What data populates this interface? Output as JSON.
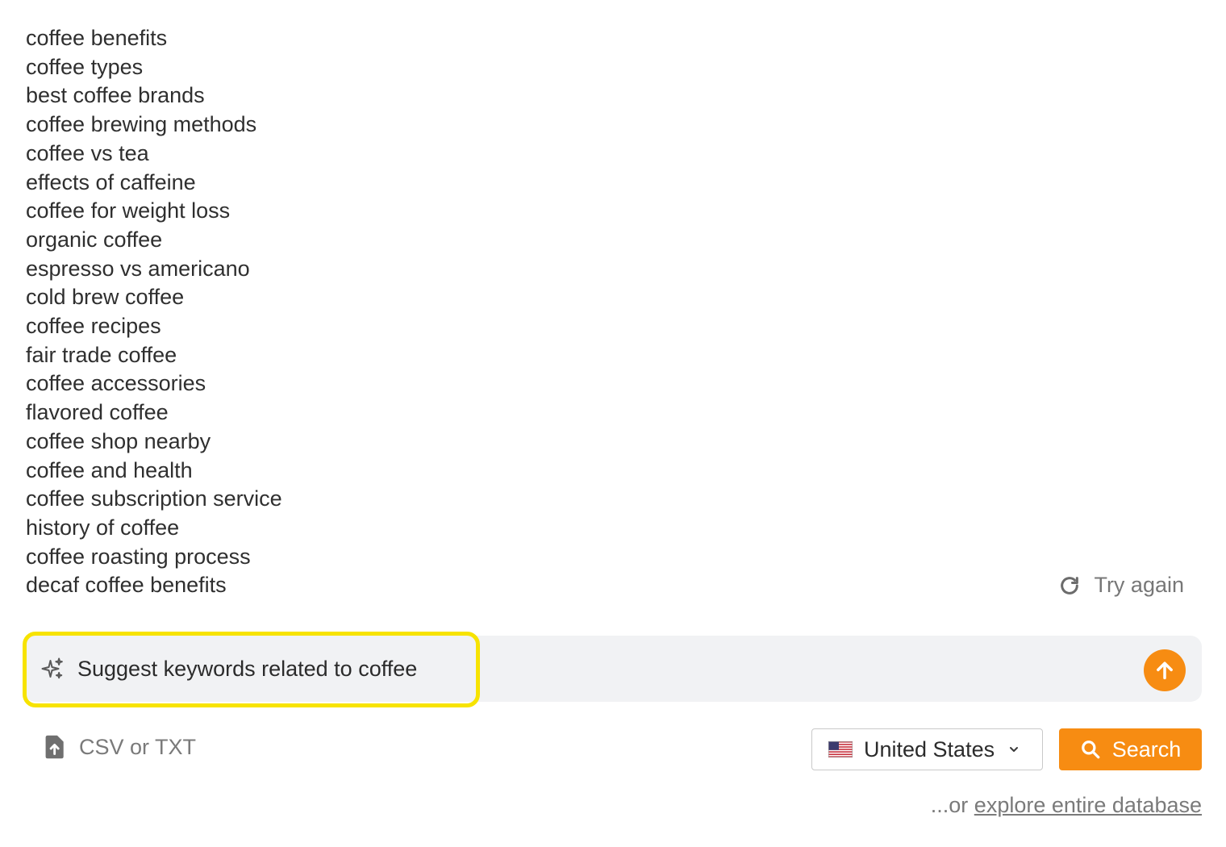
{
  "keywords": [
    "coffee benefits",
    "coffee types",
    "best coffee brands",
    "coffee brewing methods",
    "coffee vs tea",
    "effects of caffeine",
    "coffee for weight loss",
    "organic coffee",
    "espresso vs americano",
    "cold brew coffee",
    "coffee recipes",
    "fair trade coffee",
    "coffee accessories",
    "flavored coffee",
    "coffee shop nearby",
    "coffee and health",
    "coffee subscription service",
    "history of coffee",
    "coffee roasting process",
    "decaf coffee benefits"
  ],
  "actions": {
    "try_again_label": "Try again",
    "try_again_icon": "refresh-icon"
  },
  "prompt": {
    "value": "Suggest keywords related to coffee",
    "icon": "sparkles-icon",
    "send_icon": "arrow-up-icon",
    "highlight_color": "#f7e300"
  },
  "upload": {
    "label": "CSV or TXT",
    "icon": "file-upload-icon"
  },
  "country": {
    "selected": "United States",
    "flag_icon": "us-flag-icon"
  },
  "search": {
    "label": "Search",
    "icon": "search-icon"
  },
  "footer": {
    "prefix": "...or",
    "link_label": "explore entire database"
  },
  "colors": {
    "accent": "#f78c12",
    "input_bg": "#f1f2f4"
  }
}
